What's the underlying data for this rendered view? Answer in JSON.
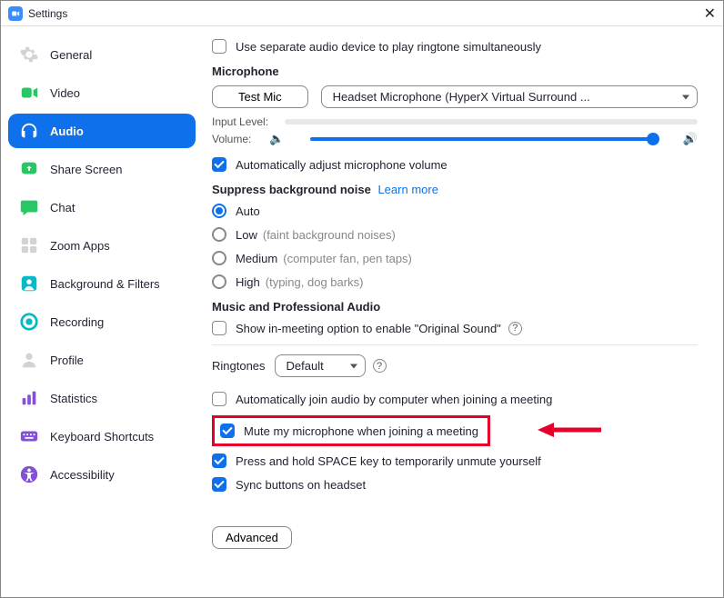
{
  "titlebar": {
    "title": "Settings"
  },
  "sidebar": {
    "items": [
      {
        "label": "General"
      },
      {
        "label": "Video"
      },
      {
        "label": "Audio"
      },
      {
        "label": "Share Screen"
      },
      {
        "label": "Chat"
      },
      {
        "label": "Zoom Apps"
      },
      {
        "label": "Background & Filters"
      },
      {
        "label": "Recording"
      },
      {
        "label": "Profile"
      },
      {
        "label": "Statistics"
      },
      {
        "label": "Keyboard Shortcuts"
      },
      {
        "label": "Accessibility"
      }
    ]
  },
  "content": {
    "separate_audio": "Use separate audio device to play ringtone simultaneously",
    "microphone_heading": "Microphone",
    "test_mic_btn": "Test Mic",
    "mic_device": "Headset Microphone (HyperX Virtual Surround ...",
    "input_level": "Input Level:",
    "volume": "Volume:",
    "auto_adjust": "Automatically adjust microphone volume",
    "suppress_heading": "Suppress background noise",
    "learn_more": "Learn more",
    "noise_auto": "Auto",
    "noise_low": "Low",
    "noise_low_hint": "(faint background noises)",
    "noise_medium": "Medium",
    "noise_medium_hint": "(computer fan, pen taps)",
    "noise_high": "High",
    "noise_high_hint": "(typing, dog barks)",
    "music_heading": "Music and Professional Audio",
    "original_sound": "Show in-meeting option to enable \"Original Sound\"",
    "ringtones_label": "Ringtones",
    "ringtones_value": "Default",
    "auto_join": "Automatically join audio by computer when joining a meeting",
    "mute_join": "Mute my microphone when joining a meeting",
    "press_hold": "Press and hold SPACE key to temporarily unmute yourself",
    "sync_headset": "Sync buttons on headset",
    "advanced_btn": "Advanced"
  }
}
